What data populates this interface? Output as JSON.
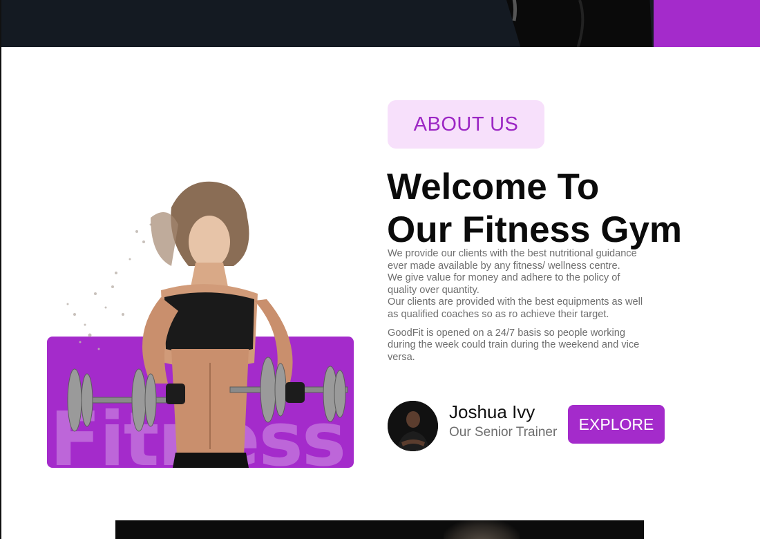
{
  "about": {
    "badge_label": "ABOUT US",
    "headline_line1": "Welcome To",
    "headline_line2": "Our Fitness Gym",
    "paragraph1": "We provide our clients with the best nutritional guidance ever made available by any fitness/ wellness centre.",
    "paragraph2": "We give value for money and adhere to the policy of quality over quantity.",
    "paragraph3": "Our clients are provided with the best equipments as well as qualified coaches so as ro achieve their target.",
    "paragraph4": "GoodFit is opened on a 24/7 basis so people working during the week could train during the weekend and vice versa.",
    "watermark": "Fitness"
  },
  "trainer": {
    "name": "Joshua Ivy",
    "role": "Our Senior Trainer"
  },
  "cta": {
    "explore_label": "EXPLORE"
  },
  "colors": {
    "accent": "#a42bcb",
    "badge_bg": "#f7e0fb",
    "dark": "#141a22"
  }
}
